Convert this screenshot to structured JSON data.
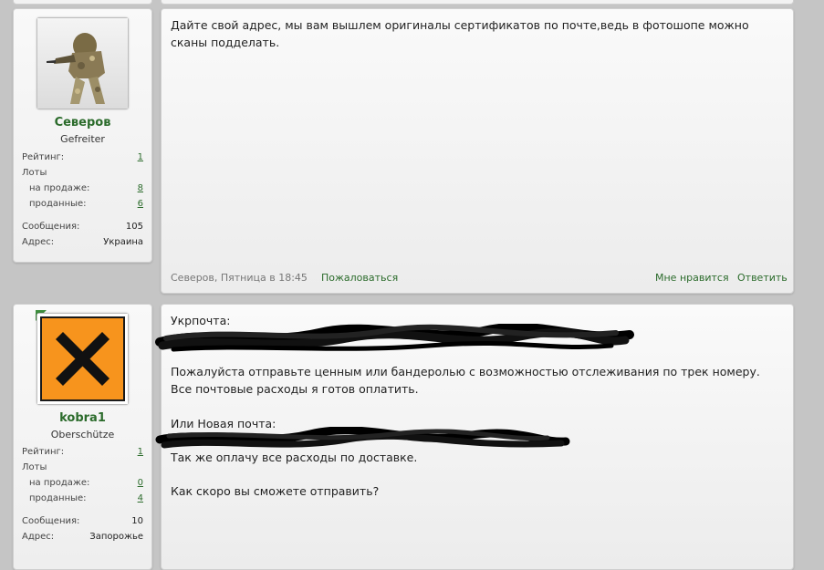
{
  "posts": [
    {
      "username": "Северов",
      "title": "Gefreiter",
      "stats": {
        "rating_label": "Рейтинг:",
        "rating": "1",
        "lots_label": "Лоты",
        "on_sale_label": "на продаже:",
        "on_sale": "8",
        "sold_label": "проданные:",
        "sold": "6",
        "messages_label": "Сообщения:",
        "messages": "105",
        "address_label": "Адрес:",
        "address": "Украина"
      },
      "body_lines": [
        "Дайте свой адрес, мы вам вышлем оригиналы сертификатов по почте,ведь в фотошопе можно",
        "сканы подделать."
      ],
      "footer": {
        "meta": "Северов, Пятница в 18:45",
        "report": "Пожаловаться",
        "like": "Мне нравится",
        "reply": "Ответить"
      }
    },
    {
      "username": "kobra1",
      "title": "Oberschütze",
      "stats": {
        "rating_label": "Рейтинг:",
        "rating": "1",
        "lots_label": "Лоты",
        "on_sale_label": "на продаже:",
        "on_sale": "0",
        "sold_label": "проданные:",
        "sold": "4",
        "messages_label": "Сообщения:",
        "messages": "10",
        "address_label": "Адрес:",
        "address": "Запорожье"
      },
      "body_lines": [
        "Укрпочта:",
        "Пожалуйста отправьте ценным или бандеролью с возможностью отслеживания по трек номеру.",
        "Все почтовые расходы я готов оплатить.",
        "Или Новая почта:",
        "Так же оплачу все расходы по доставке.",
        "Как скоро вы сможете отправить?"
      ]
    }
  ],
  "colors": {
    "accent_green": "#2b6b2b",
    "hazard_orange": "#f7941d"
  }
}
